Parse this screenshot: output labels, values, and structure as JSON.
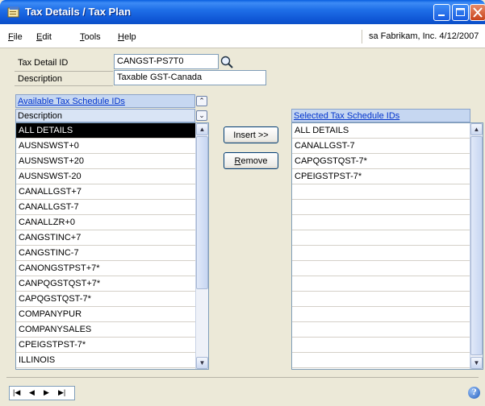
{
  "window": {
    "title": "Tax Details / Tax Plan"
  },
  "menu": {
    "items": [
      {
        "label": "File",
        "accel": "F",
        "rest": "ile"
      },
      {
        "label": "Edit",
        "accel": "E",
        "rest": "dit"
      },
      {
        "label": "Tools",
        "accel": "T",
        "rest": "ools"
      },
      {
        "label": "Help",
        "accel": "H",
        "rest": "elp"
      }
    ],
    "user_info": "sa  Fabrikam, Inc.  4/12/2007"
  },
  "form": {
    "tax_detail_id_label": "Tax Detail ID",
    "tax_detail_id_value": "CANGST-PS7T0",
    "description_label": "Description",
    "description_value": "Taxable GST-Canada"
  },
  "available": {
    "header": "Available Tax Schedule IDs",
    "column": "Description",
    "items": [
      "ALL DETAILS",
      "AUSNSWST+0",
      "AUSNSWST+20",
      "AUSNSWST-20",
      "CANALLGST+7",
      "CANALLGST-7",
      "CANALLZR+0",
      "CANGSTINC+7",
      "CANGSTINC-7",
      "CANONGSTPST+7*",
      "CANPQGSTQST+7*",
      "CAPQGSTQST-7*",
      "COMPANYPUR",
      "COMPANYSALES",
      "CPEIGSTPST-7*",
      "ILLINOIS"
    ],
    "selected_index": 0
  },
  "buttons": {
    "insert": "Insert >>",
    "remove_accel": "R",
    "remove_rest": "emove"
  },
  "selected": {
    "header": "Selected Tax Schedule IDs",
    "items": [
      "ALL DETAILS",
      "CANALLGST-7",
      "CAPQGSTQST-7*",
      "CPEIGSTPST-7*",
      "",
      "",
      "",
      "",
      "",
      "",
      "",
      "",
      "",
      "",
      "",
      ""
    ]
  },
  "bottom": {
    "nav": {
      "first": "|◀",
      "prev": "◀",
      "next": "▶",
      "last": "▶|"
    },
    "help_icon": "?"
  }
}
